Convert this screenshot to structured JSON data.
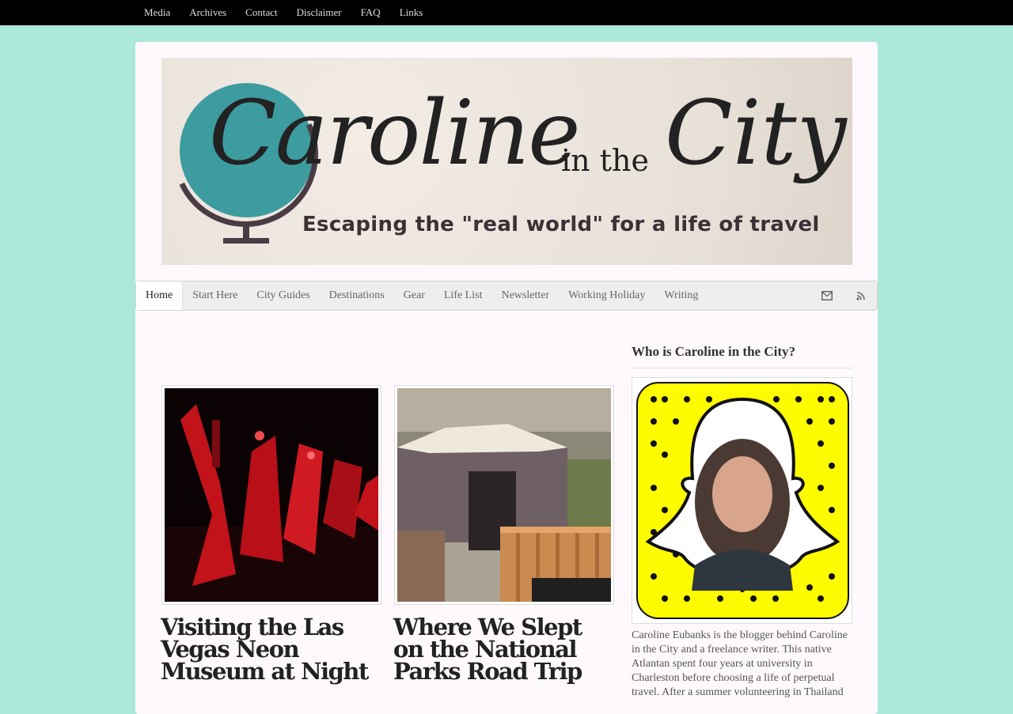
{
  "topnav": {
    "items": [
      "Media",
      "Archives",
      "Contact",
      "Disclaimer",
      "FAQ",
      "Links"
    ]
  },
  "banner": {
    "title_part1": "Caroline",
    "title_part2": "in the",
    "title_part3": "City",
    "tagline": "Escaping the \"real world\" for a life of travel"
  },
  "mainnav": {
    "items": [
      "Home",
      "Start Here",
      "City Guides",
      "Destinations",
      "Gear",
      "Life List",
      "Newsletter",
      "Working Holiday",
      "Writing"
    ],
    "active": "Home",
    "icons": [
      "email-icon",
      "rss-icon"
    ]
  },
  "posts": [
    {
      "title": "Visiting the Las Vegas Neon Museum at Night"
    },
    {
      "title": "Where We Slept on the National Parks Road Trip"
    }
  ],
  "sidebar": {
    "heading": "Who is Caroline in the City?",
    "bio": "Caroline Eubanks is the blogger behind Caroline in the City and a freelance writer. This native Atlantan spent four years at university in Charleston before choosing a life of perpetual travel. After a summer volunteering in Thailand"
  },
  "colors": {
    "page_bg": "#abe9d9",
    "topbar_bg": "#000000",
    "globe": "#3d9ca0",
    "snapcode": "#fffc00"
  }
}
